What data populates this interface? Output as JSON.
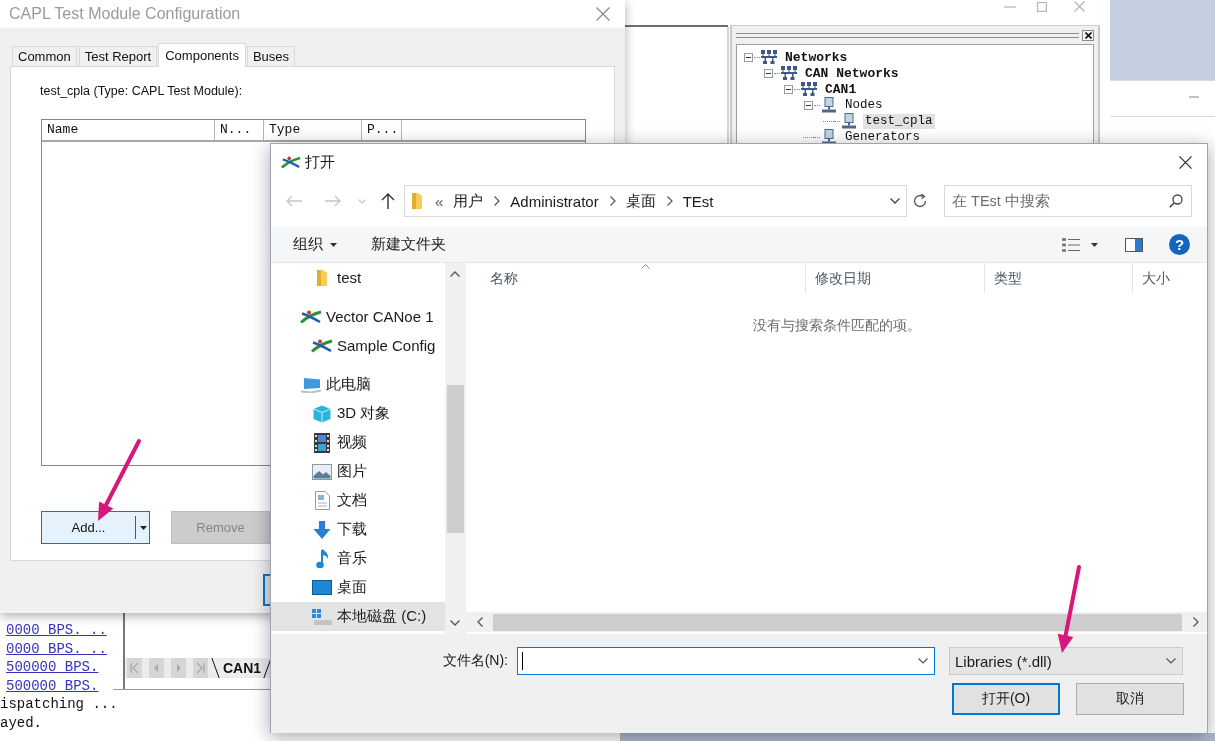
{
  "capl_dialog": {
    "title": "CAPL Test Module Configuration",
    "tabs": [
      {
        "label": "Common",
        "selected": false
      },
      {
        "label": "Test Report",
        "selected": false
      },
      {
        "label": "Components",
        "selected": true
      },
      {
        "label": "Buses",
        "selected": false
      }
    ],
    "module_label": "test_cpla (Type: CAPL Test Module):",
    "columns": [
      "Name",
      "N...",
      "Type",
      "P..."
    ],
    "buttons": [
      {
        "label": "Add...",
        "kind": "split",
        "disabled": false
      },
      {
        "label": "Remove",
        "kind": "plain",
        "disabled": true
      }
    ]
  },
  "network_tree": [
    {
      "label": "Networks",
      "kind": "network",
      "expanded": true,
      "selected": false,
      "children": [
        {
          "label": "CAN Networks",
          "kind": "network",
          "expanded": true,
          "selected": false,
          "children": [
            {
              "label": "CAN1",
              "kind": "network",
              "expanded": true,
              "selected": false,
              "children": [
                {
                  "label": "Nodes",
                  "kind": "node",
                  "expanded": true,
                  "selected": false,
                  "children": [
                    {
                      "label": "test_cpla",
                      "kind": "node",
                      "selected": true
                    }
                  ]
                },
                {
                  "label": "Generators",
                  "kind": "node",
                  "selected": false
                }
              ]
            }
          ]
        }
      ]
    }
  ],
  "output_log": [
    {
      "text": "0000 BPS. ..",
      "kind": "link"
    },
    {
      "text": "0000 BPS. ..",
      "kind": "link"
    },
    {
      "text": "500000 BPS.",
      "kind": "link"
    },
    {
      "text": "500000 BPS.",
      "kind": "link"
    },
    {
      "text": "ispatching ...",
      "kind": "plain"
    },
    {
      "text": "ayed.",
      "kind": "plain"
    }
  ],
  "bus_tabs": [
    {
      "label": "CAN1",
      "selected": true
    }
  ],
  "open_dialog": {
    "title": "打开",
    "address": {
      "overflow": "«",
      "crumbs": [
        "用户",
        "Administrator",
        "桌面",
        "TEst"
      ]
    },
    "search": {
      "placeholder": "在 TEst 中搜索"
    },
    "toolbar": {
      "organize": "组织",
      "new_folder": "新建文件夹",
      "help": "?"
    },
    "nav_pane": {
      "scrolled_group_children": [
        {
          "label": "test",
          "kind": "folder",
          "selected": false
        }
      ],
      "tree": [
        {
          "label": "Vector CANoe 1",
          "kind": "logo",
          "selected": false,
          "children": [
            {
              "label": "Sample Config",
              "kind": "logo",
              "selected": false
            }
          ]
        },
        {
          "label": "此电脑",
          "kind": "pc",
          "selected": false,
          "children": [
            {
              "label": "3D 对象",
              "kind": "cube",
              "selected": false
            },
            {
              "label": "视频",
              "kind": "film",
              "selected": false
            },
            {
              "label": "图片",
              "kind": "picture",
              "selected": false
            },
            {
              "label": "文档",
              "kind": "document",
              "selected": false
            },
            {
              "label": "下载",
              "kind": "download",
              "selected": false
            },
            {
              "label": "音乐",
              "kind": "music",
              "selected": false
            },
            {
              "label": "桌面",
              "kind": "desktop",
              "selected": false
            },
            {
              "label": "本地磁盘 (C:)",
              "kind": "drive",
              "selected": true
            }
          ]
        }
      ]
    },
    "columns": [
      {
        "label": "名称",
        "sorted": true
      },
      {
        "label": "修改日期",
        "sorted": false
      },
      {
        "label": "类型",
        "sorted": false
      },
      {
        "label": "大小",
        "sorted": false
      }
    ],
    "empty_message": "没有与搜索条件匹配的项。",
    "file_name": {
      "label": "文件名(N):",
      "focused": true
    },
    "file_type": "Libraries (*.dll)",
    "buttons": [
      {
        "label": "打开(O)",
        "default": true
      },
      {
        "label": "取消",
        "default": false
      }
    ]
  }
}
